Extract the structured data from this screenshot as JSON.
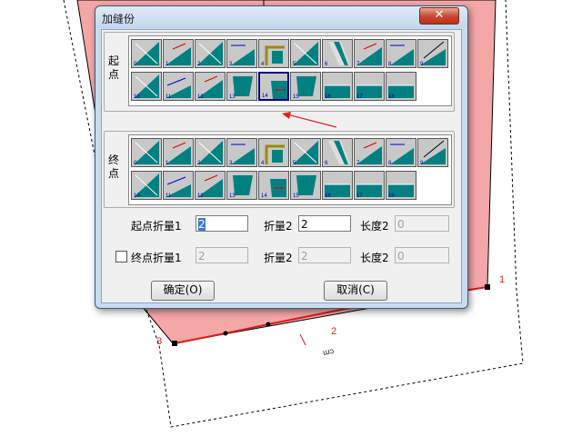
{
  "dialog": {
    "title": "加缝份",
    "close_symbol": "✕"
  },
  "start_group": {
    "label": "起点",
    "selected_tile": "14"
  },
  "end_group": {
    "label": "终点"
  },
  "start_tiles": [
    {
      "num": "0",
      "style": "a",
      "colour": "#008080"
    },
    {
      "num": "1",
      "style": "b",
      "colour": "#008080"
    },
    {
      "num": "2",
      "style": "a",
      "colour": "#008080"
    },
    {
      "num": "3",
      "style": "c",
      "colour": "#008080"
    },
    {
      "num": "4",
      "style": "d",
      "colour": "#008080"
    },
    {
      "num": "5",
      "style": "a",
      "colour": "#008080"
    },
    {
      "num": "6",
      "style": "e",
      "colour": "#008080"
    },
    {
      "num": "7",
      "style": "b",
      "colour": "#008080"
    },
    {
      "num": "8",
      "style": "c",
      "colour": "#008080"
    },
    {
      "num": "9",
      "style": "f",
      "colour": "#008080"
    },
    {
      "num": "10",
      "style": "a",
      "colour": "#008080"
    },
    {
      "num": "11",
      "style": "g",
      "colour": "#008080"
    },
    {
      "num": "12",
      "style": "b",
      "colour": "#008080"
    },
    {
      "num": "13",
      "style": "h",
      "colour": "#008080"
    },
    {
      "num": "14",
      "style": "i",
      "colour": "#008080"
    },
    {
      "num": "15",
      "style": "h",
      "colour": "#008080"
    },
    {
      "num": "16",
      "style": "j",
      "colour": "#008080"
    },
    {
      "num": "17",
      "style": "j",
      "colour": "#008080"
    },
    {
      "num": "18",
      "style": "j",
      "colour": "#008080"
    }
  ],
  "end_tiles": [
    {
      "num": "0",
      "style": "a",
      "colour": "#008080"
    },
    {
      "num": "1",
      "style": "b",
      "colour": "#008080"
    },
    {
      "num": "2",
      "style": "a",
      "colour": "#008080"
    },
    {
      "num": "3",
      "style": "c",
      "colour": "#008080"
    },
    {
      "num": "4",
      "style": "d",
      "colour": "#008080"
    },
    {
      "num": "5",
      "style": "a",
      "colour": "#008080"
    },
    {
      "num": "6",
      "style": "e",
      "colour": "#008080"
    },
    {
      "num": "7",
      "style": "b",
      "colour": "#008080"
    },
    {
      "num": "8",
      "style": "c",
      "colour": "#008080"
    },
    {
      "num": "9",
      "style": "f",
      "colour": "#008080"
    },
    {
      "num": "10",
      "style": "a",
      "colour": "#008080"
    },
    {
      "num": "11",
      "style": "g",
      "colour": "#008080"
    },
    {
      "num": "12",
      "style": "b",
      "colour": "#008080"
    },
    {
      "num": "13",
      "style": "h",
      "colour": "#008080"
    },
    {
      "num": "14",
      "style": "i",
      "colour": "#008080"
    },
    {
      "num": "15",
      "style": "h",
      "colour": "#008080"
    },
    {
      "num": "16",
      "style": "j",
      "colour": "#008080"
    },
    {
      "num": "17",
      "style": "j",
      "colour": "#008080"
    },
    {
      "num": "18",
      "style": "j",
      "colour": "#008080"
    }
  ],
  "row1": {
    "label": "起点折量1",
    "value1": "2",
    "label2": "折量2",
    "value2": "2",
    "label3": "长度2",
    "value3": "0"
  },
  "row2": {
    "label": "终点折量1",
    "value1": "2",
    "label2": "折量2",
    "value2": "2",
    "label3": "长度2",
    "value3": "0",
    "checked": false
  },
  "buttons": {
    "ok": "确定(O)",
    "cancel": "取消(C)"
  },
  "cad": {
    "point_labels": [
      "1",
      "2",
      "3"
    ],
    "small_text": "ɯↄ",
    "colors": {
      "fill": "#f4a0a0",
      "line": "#d41c1c"
    }
  }
}
